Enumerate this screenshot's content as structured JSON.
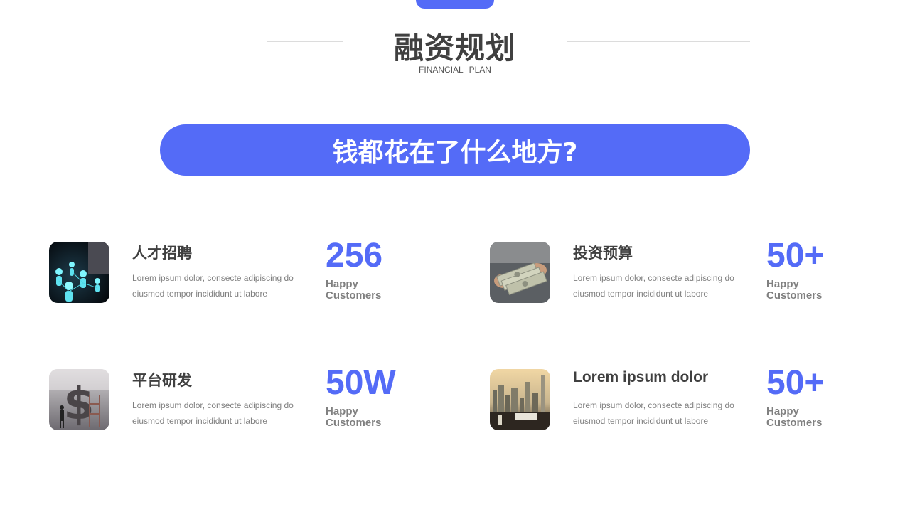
{
  "header": {
    "title": "融资规划",
    "subtitle": "FINANCIAL PLAN"
  },
  "banner": {
    "question": "钱都花在了什么地方?"
  },
  "items": [
    {
      "title": "人才招聘",
      "description": "Lorem ipsum dolor, consecte adipiscing do eiusmod tempor incididunt ut labore",
      "stat_value": "256",
      "stat_label": "Happy Customers",
      "image_icon": "network-people-image"
    },
    {
      "title": "投资预算",
      "description": "Lorem ipsum dolor, consecte adipiscing do eiusmod tempor incididunt ut labore",
      "stat_value": "50+",
      "stat_label": "Happy Customers",
      "image_icon": "cash-money-image"
    },
    {
      "title": "平台研发",
      "description": "Lorem ipsum dolor, consecte adipiscing do eiusmod tempor incididunt ut labore",
      "stat_value": "50W",
      "stat_label": "Happy Customers",
      "image_icon": "dollar-sign-businessman-image"
    },
    {
      "title": "Lorem ipsum dolor",
      "description": "Lorem ipsum dolor, consecte adipiscing do eiusmod tempor incididunt ut labore",
      "stat_value": "50+",
      "stat_label": "Happy Customers",
      "image_icon": "city-view-desk-image"
    }
  ],
  "colors": {
    "accent": "#546bf7",
    "title_text": "#404040",
    "muted_text": "#808080"
  }
}
